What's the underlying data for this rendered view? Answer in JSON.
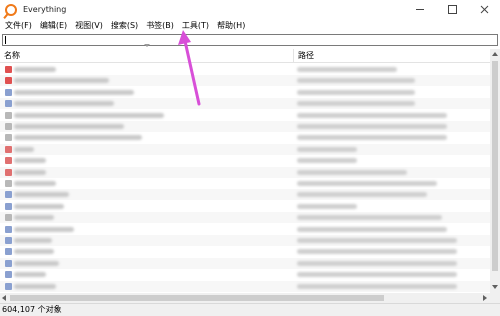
{
  "window": {
    "title": "Everything"
  },
  "menu": {
    "items": [
      "文件(F)",
      "编辑(E)",
      "视图(V)",
      "搜索(S)",
      "书签(B)",
      "工具(T)",
      "帮助(H)"
    ]
  },
  "search": {
    "value": ""
  },
  "columns": {
    "name": "名称",
    "path": "路径"
  },
  "status": {
    "count_text": "604,107 个对象"
  },
  "colors": {
    "accent": "#f07a1a",
    "annotation_arrow": "#d84fd8",
    "row_stripe": "#f7f7f7",
    "blur_text": "#c9c9c9"
  },
  "icons": {
    "app": "everything-logo-icon",
    "close": "close-icon",
    "minimize": "minimize-icon",
    "maximize": "maximize-icon"
  }
}
